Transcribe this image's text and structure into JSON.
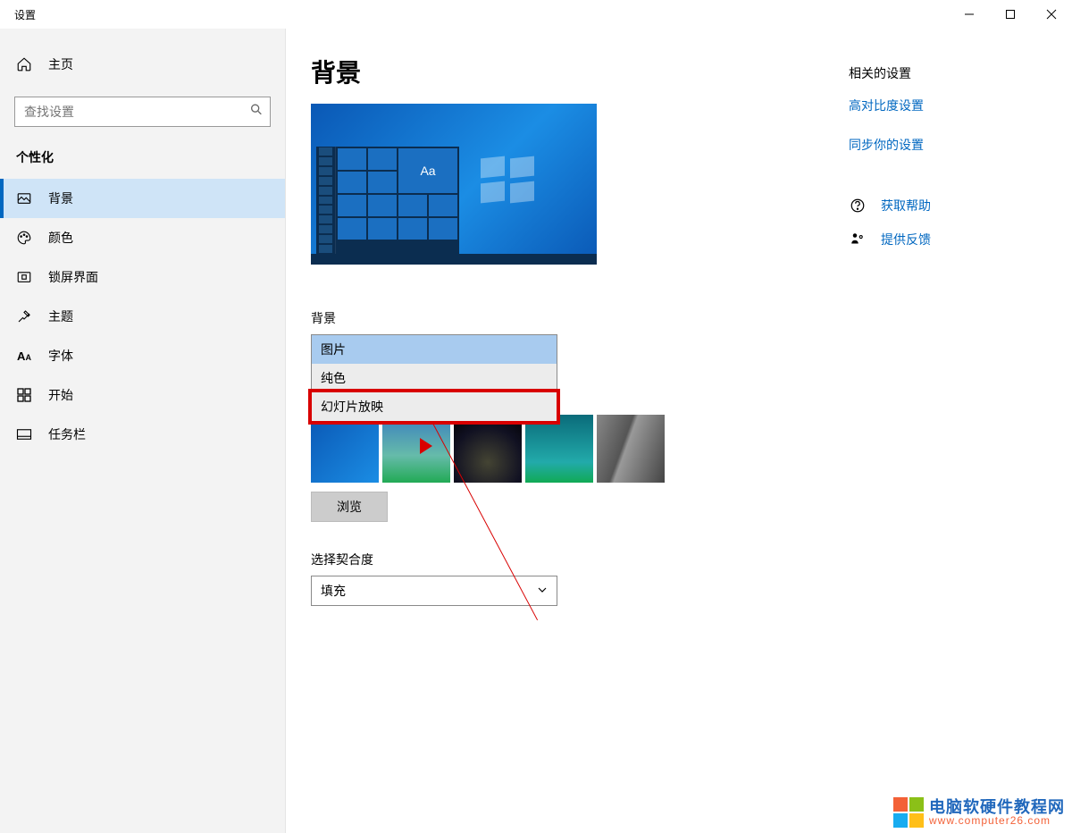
{
  "window": {
    "title": "设置"
  },
  "sidebar": {
    "home": "主页",
    "search_placeholder": "查找设置",
    "section": "个性化",
    "items": [
      {
        "label": "背景",
        "active": true
      },
      {
        "label": "颜色",
        "active": false
      },
      {
        "label": "锁屏界面",
        "active": false
      },
      {
        "label": "主题",
        "active": false
      },
      {
        "label": "字体",
        "active": false
      },
      {
        "label": "开始",
        "active": false
      },
      {
        "label": "任务栏",
        "active": false
      }
    ]
  },
  "page": {
    "title": "背景",
    "preview_sample_text": "Aa",
    "background_label": "背景",
    "dropdown": {
      "options": [
        "图片",
        "纯色",
        "幻灯片放映"
      ],
      "selected": "图片",
      "highlighted_index": 2
    },
    "browse_button": "浏览",
    "fit_label": "选择契合度",
    "fit_value": "填充"
  },
  "rail": {
    "title": "相关的设置",
    "links": [
      "高对比度设置",
      "同步你的设置"
    ],
    "help": "获取帮助",
    "feedback": "提供反馈"
  },
  "watermark": {
    "line1": "电脑软硬件教程网",
    "line2": "www.computer26.com"
  }
}
